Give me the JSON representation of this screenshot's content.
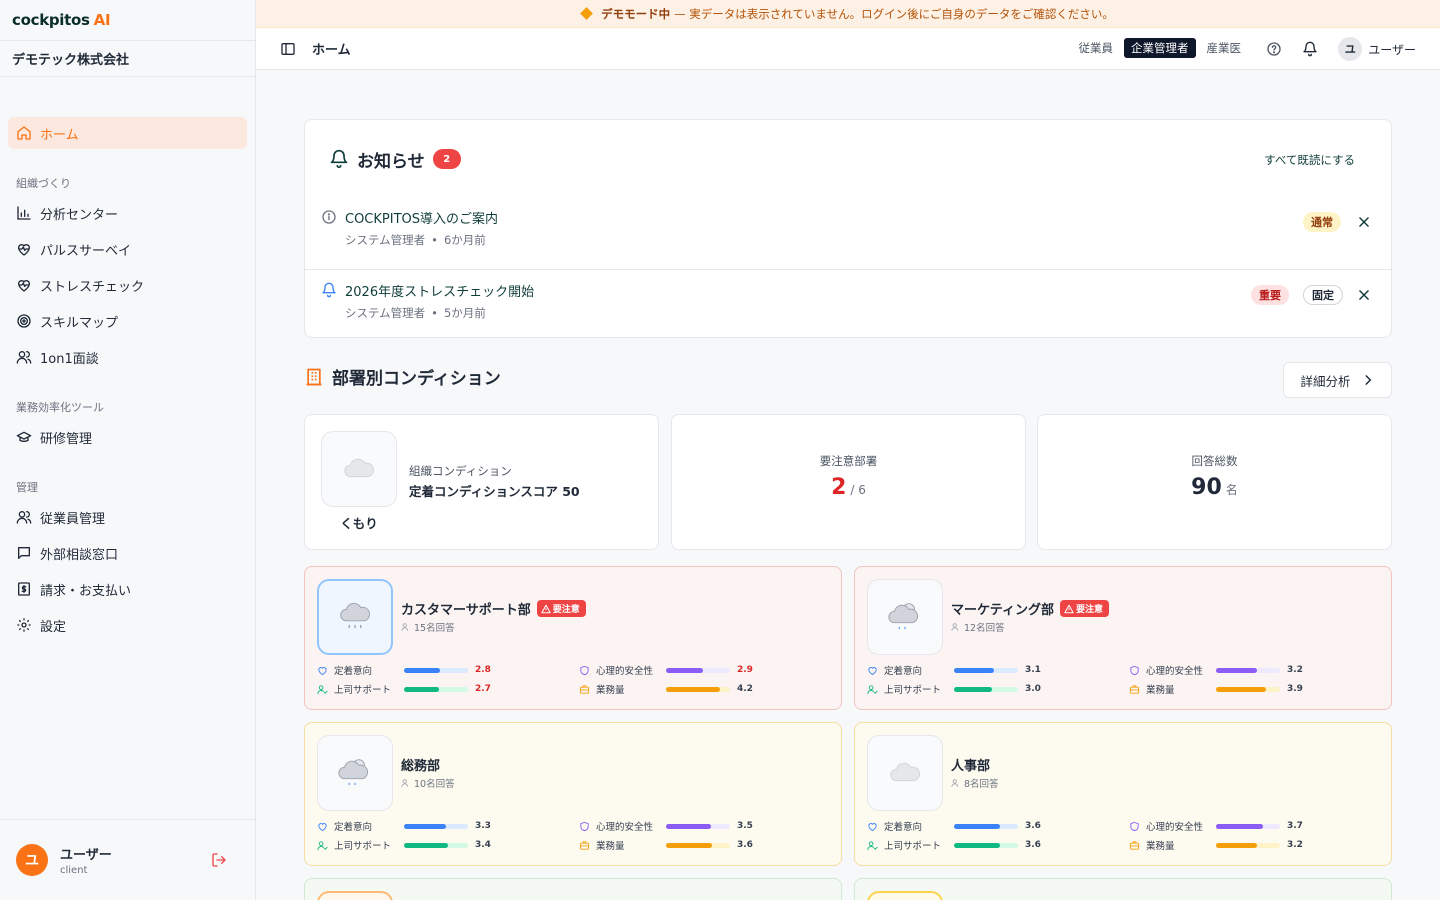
{
  "brand": {
    "name": "cockpitos",
    "suffix": "AI"
  },
  "company": "デモテック株式会社",
  "nav": {
    "home": "ホーム",
    "sec1": "組織づくり",
    "analysis": "分析センター",
    "pulse": "パルスサーベイ",
    "stress": "ストレスチェック",
    "skill": "スキルマップ",
    "oneonone": "1on1面談",
    "sec2": "業務効率化ツール",
    "training": "研修管理",
    "sec3": "管理",
    "employees": "従業員管理",
    "consult": "外部相談窓口",
    "billing": "請求・お支払い",
    "settings": "設定"
  },
  "footer": {
    "avatar": "ユ",
    "name": "ユーザー",
    "role": "client"
  },
  "banner": {
    "strong": "デモモード中",
    "text": "— 実データは表示されていません。ログイン後にご自身のデータをご確認ください。"
  },
  "header": {
    "title": "ホーム",
    "roles": [
      "従業員",
      "企業管理者",
      "産業医"
    ],
    "avatar": "ユ",
    "user": "ユーザー"
  },
  "notices": {
    "title": "お知らせ",
    "count": "2",
    "mark_all": "すべて既読にする",
    "items": [
      {
        "title": "COCKPITOS導入のご案内",
        "author": "システム管理者",
        "time": "6か月前",
        "tags": [
          "通常"
        ]
      },
      {
        "title": "2026年度ストレスチェック開始",
        "author": "システム管理者",
        "time": "5か月前",
        "tags": [
          "重要",
          "固定"
        ]
      }
    ]
  },
  "dept_section": {
    "title": "部署別コンディション",
    "detail_button": "詳細分析",
    "org": {
      "weather": "くもり",
      "label": "組織コンディション",
      "score_text": "定着コンディションスコア 50"
    },
    "attention": {
      "label": "要注意部署",
      "value": "2",
      "total": "/ 6"
    },
    "responses": {
      "label": "回答総数",
      "value": "90",
      "unit": "名"
    }
  },
  "metric_labels": {
    "m1": "定着意向",
    "m2": "心理的安全性",
    "m3": "上司サポート",
    "m4": "業務量"
  },
  "warn_badge": "要注意",
  "departments": [
    {
      "name": "カスタマーサポート部",
      "responses": "15名回答",
      "warning": true,
      "m1": 2.8,
      "m2": 2.9,
      "m3": 2.7,
      "m4": 4.2
    },
    {
      "name": "マーケティング部",
      "responses": "12名回答",
      "warning": true,
      "m1": 3.1,
      "m2": 3.2,
      "m3": 3.0,
      "m4": 3.9
    },
    {
      "name": "総務部",
      "responses": "10名回答",
      "warning": false,
      "m1": 3.3,
      "m2": 3.5,
      "m3": 3.4,
      "m4": 3.6
    },
    {
      "name": "人事部",
      "responses": "8名回答",
      "warning": false,
      "m1": 3.6,
      "m2": 3.7,
      "m3": 3.6,
      "m4": 3.2
    }
  ],
  "colors": {
    "accent": "#f97316",
    "danger": "#ef4444",
    "metric1": "#3b82f6",
    "metric2": "#8b5cf6",
    "metric3": "#10b981",
    "metric4": "#f59e0b"
  }
}
